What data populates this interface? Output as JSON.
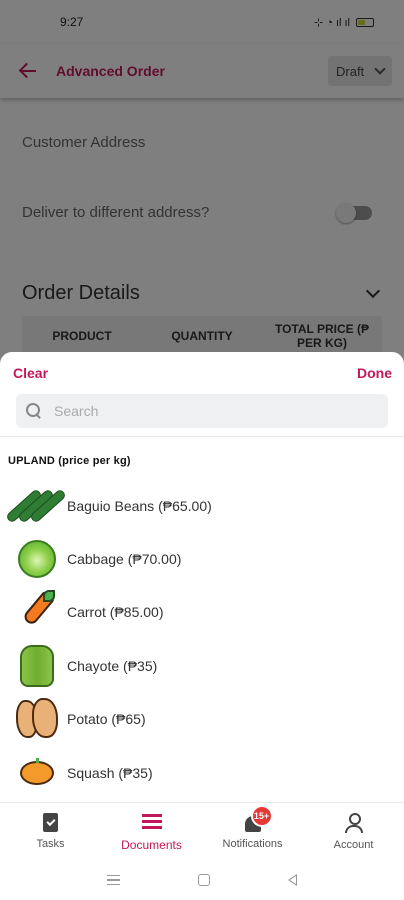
{
  "status_bar": {
    "time": "9:27",
    "icons": "⊹ ◔ ıl ıl"
  },
  "app_bar": {
    "title": "Advanced Order",
    "status_value": "Draft"
  },
  "form": {
    "customer_address_label": "Customer Address",
    "deliver_label": "Deliver to different address?",
    "section_title": "Order Details",
    "table_headers": [
      "PRODUCT",
      "QUANTITY",
      "TOTAL PRICE (₱ PER KG)"
    ]
  },
  "sheet": {
    "clear_label": "Clear",
    "done_label": "Done",
    "search_placeholder": "Search",
    "group_label": "UPLAND  (price per kg)",
    "items": [
      {
        "label": "Baguio Beans (₱65.00)",
        "icon": "beans-icon"
      },
      {
        "label": "Cabbage (₱70.00)",
        "icon": "cabbage-icon"
      },
      {
        "label": "Carrot (₱85.00)",
        "icon": "carrot-icon"
      },
      {
        "label": "Chayote (₱35)",
        "icon": "chayote-icon"
      },
      {
        "label": "Potato (₱65)",
        "icon": "potato-icon"
      },
      {
        "label": "Squash (₱35)",
        "icon": "squash-icon"
      }
    ]
  },
  "bottom_nav": {
    "items": [
      {
        "label": "Tasks"
      },
      {
        "label": "Documents"
      },
      {
        "label": "Notifications",
        "badge": "15+"
      },
      {
        "label": "Account"
      }
    ],
    "active": "Documents"
  },
  "colors": {
    "accent": "#c2185b",
    "badge": "#e53935"
  }
}
